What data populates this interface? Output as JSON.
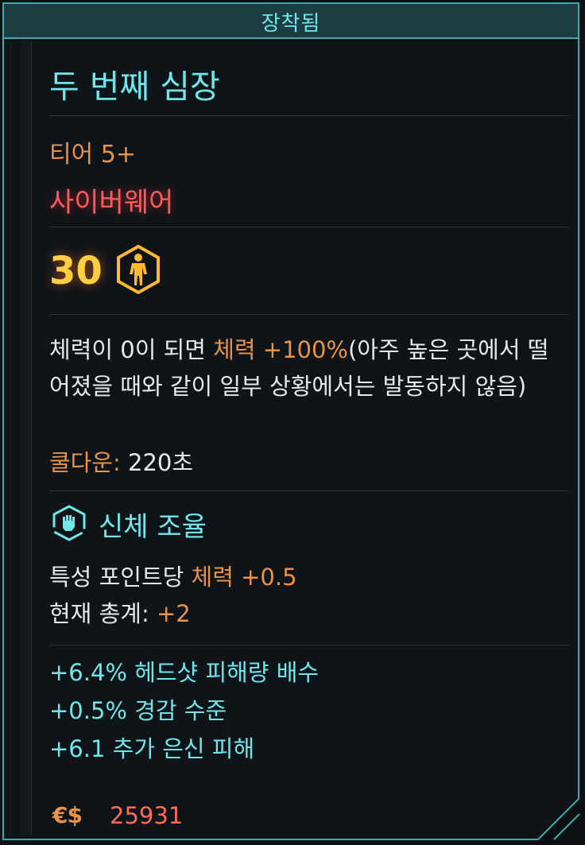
{
  "header": {
    "title": "장착됨"
  },
  "item": {
    "name": "두 번째 심장",
    "tier": "티어 5+",
    "type": "사이버웨어",
    "required_level": "30",
    "description": {
      "part1": "체력이 0이 되면 ",
      "highlight": "체력 +100%",
      "part2": "(아주 높은 곳에서 떨어졌을 때와 같이 일부 상황에서는 발동하지 않음)"
    },
    "cooldown": {
      "label": "쿨다운:",
      "value": " 220초"
    }
  },
  "perk": {
    "icon": "fist-shield-icon",
    "title": "신체 조율",
    "per_point_prefix": "특성 포인트당 ",
    "per_point_value": "체력 +0.5",
    "total_label": "현재 총계: ",
    "total_value": "+2"
  },
  "stats": [
    "+6.4%  헤드샷 피해량 배수",
    "+0.5%  경감 수준",
    "+6.1  추가 은신 피해"
  ],
  "price": {
    "currency_symbol": "€$",
    "value": "25931"
  },
  "colors": {
    "accent": "#6ee6ea",
    "orange": "#e8924a",
    "red": "#ff5a5a",
    "border": "#3fa9ae"
  }
}
